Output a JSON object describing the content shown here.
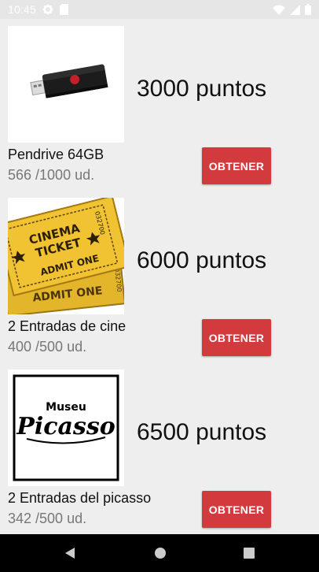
{
  "status_bar": {
    "time": "10:45",
    "icons": [
      "gear-icon",
      "sd-card-icon",
      "wifi-icon",
      "signal-icon",
      "battery-icon"
    ]
  },
  "products": [
    {
      "image_icon": "usb-drive-image",
      "points": "3000 puntos",
      "name": "Pendrive 64GB",
      "stock": "566 /1000 ud.",
      "button_label": "OBTENER"
    },
    {
      "image_icon": "cinema-ticket-image",
      "image_text": [
        "CINEMA",
        "TICKET",
        "ADMIT ONE",
        "ADMIT ONE",
        "032700",
        "032700"
      ],
      "points": "6000 puntos",
      "name": "2 Entradas de cine",
      "stock": "400 /500 ud.",
      "button_label": "OBTENER"
    },
    {
      "image_icon": "museu-picasso-logo",
      "image_text": [
        "Museu",
        "Picasso"
      ],
      "points": "6500 puntos",
      "name": "2 Entradas del picasso",
      "stock": "342 /500 ud.",
      "button_label": "OBTENER"
    }
  ],
  "nav_bar": {
    "icons": [
      "back-icon",
      "home-icon",
      "recents-icon"
    ]
  },
  "colors": {
    "accent_button": "#d23a3e",
    "background": "#eeeeee",
    "divider": "#cfcfcf",
    "nav_bar": "#000000"
  }
}
